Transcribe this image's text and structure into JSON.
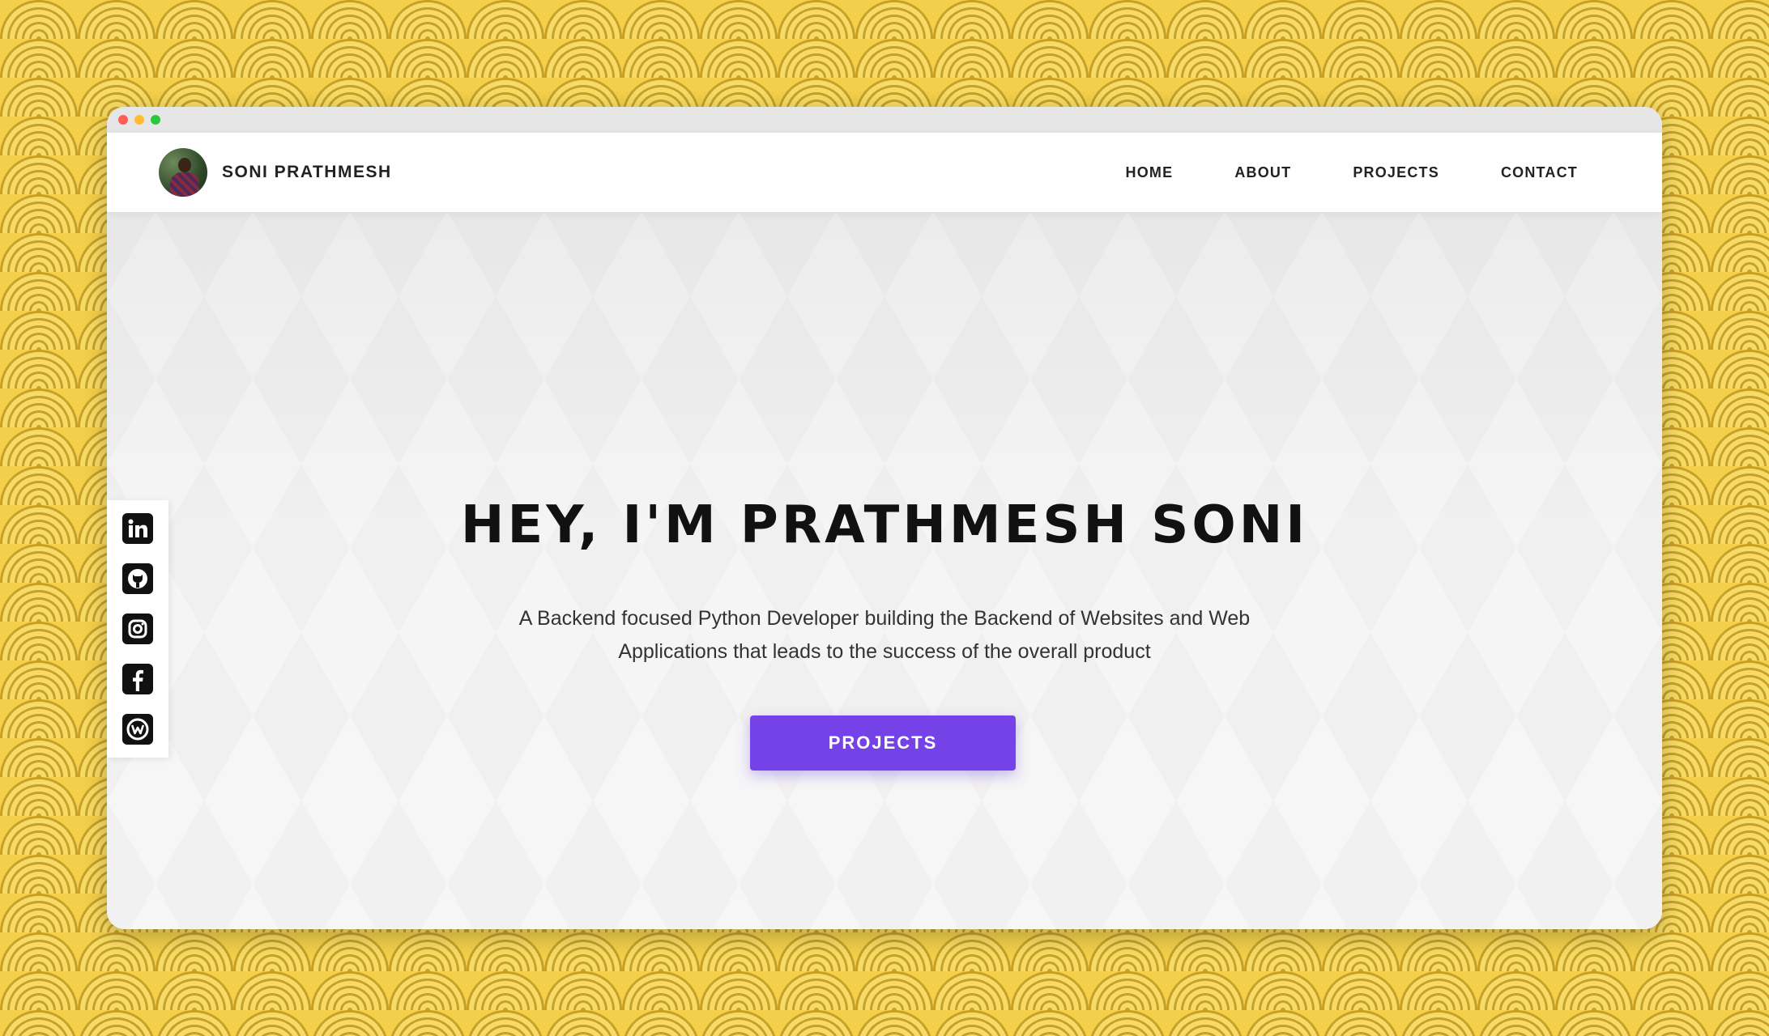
{
  "window": {
    "controls": {
      "close_color": "#ff5f57",
      "minimize_color": "#febc2e",
      "maximize_color": "#28c840"
    }
  },
  "navbar": {
    "brand_name": "SONI PRATHMESH",
    "links": [
      "HOME",
      "ABOUT",
      "PROJECTS",
      "CONTACT"
    ]
  },
  "social": {
    "icons": [
      "linkedin-icon",
      "github-icon",
      "instagram-icon",
      "facebook-icon",
      "wattpad-icon"
    ]
  },
  "hero": {
    "title": "HEY, I'M PRATHMESH SONI",
    "subtitle": "A Backend focused Python Developer building the Backend of Websites and Web Applications that leads to the success of the overall product",
    "cta_label": "PROJECTS"
  },
  "colors": {
    "accent": "#7442e6",
    "background_pattern": "#f2d04c",
    "text_dark": "#111111"
  }
}
